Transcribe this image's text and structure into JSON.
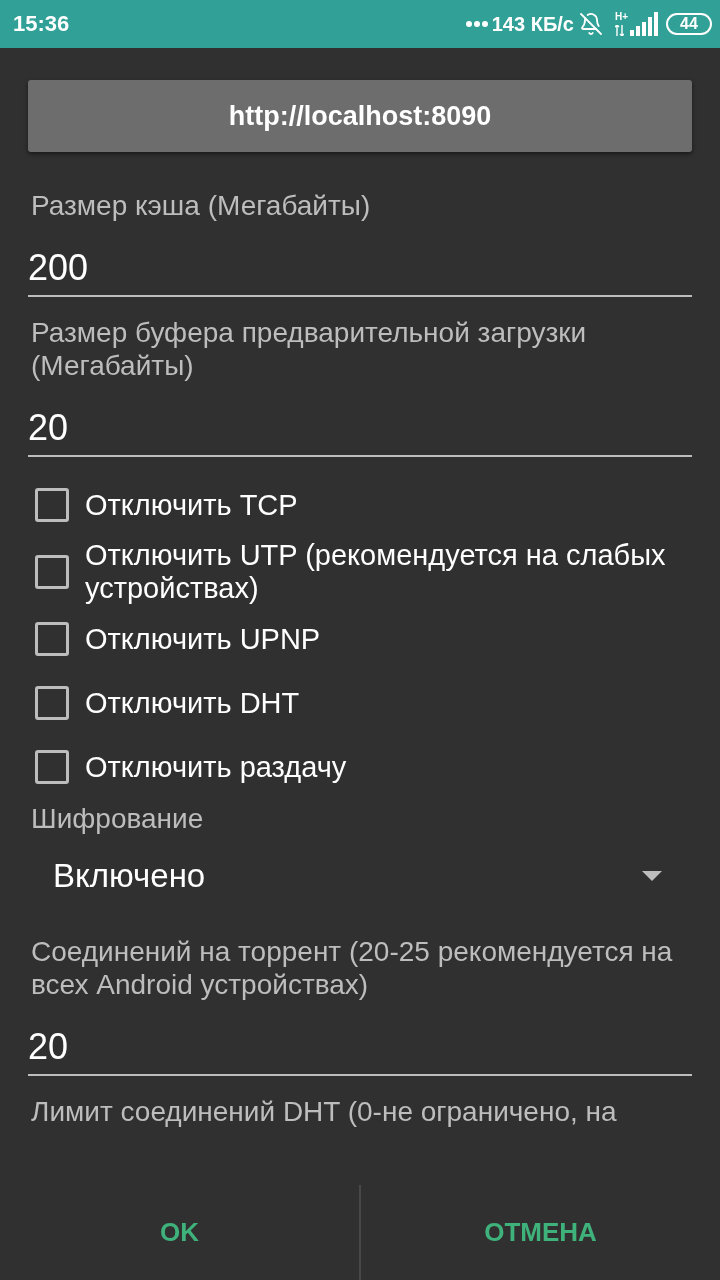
{
  "status_bar": {
    "time": "15:36",
    "network_speed": "143 КБ/с",
    "network_type": "H+",
    "battery": "44"
  },
  "server_button": {
    "label": "http://localhost:8090"
  },
  "settings": [
    {
      "kind": "field",
      "label": "Размер кэша (Мегабайты)",
      "value": "200"
    },
    {
      "kind": "field",
      "label": "Размер буфера предварительной загрузки (Мегабайты)",
      "value": "20"
    },
    {
      "kind": "checkbox",
      "label": "Отключить TCP",
      "checked": false
    },
    {
      "kind": "checkbox",
      "label": "Отключить UTP (рекомендуется на слабых устройствах)",
      "checked": false
    },
    {
      "kind": "checkbox",
      "label": "Отключить UPNP",
      "checked": false
    },
    {
      "kind": "checkbox",
      "label": "Отключить DHT",
      "checked": false
    },
    {
      "kind": "checkbox",
      "label": "Отключить раздачу",
      "checked": false
    },
    {
      "kind": "dropdown",
      "label": "Шифрование",
      "value": "Включено"
    },
    {
      "kind": "field",
      "label": "Соединений на торрент (20-25 рекомендуется на всех Android устройствах)",
      "value": "20"
    },
    {
      "kind": "field",
      "label": "Лимит соединений DHT (0-не ограничено, на"
    }
  ],
  "buttons": [
    {
      "label": "OK"
    },
    {
      "label": "ОТМЕНА"
    }
  ]
}
